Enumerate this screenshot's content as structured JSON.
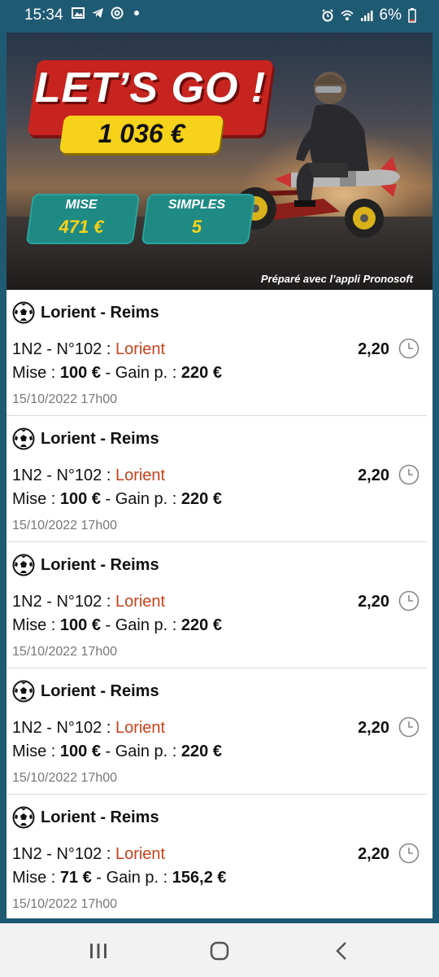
{
  "status_bar": {
    "time": "15:34",
    "battery": "6%",
    "left_icons": [
      "image-icon",
      "telegram-icon",
      "at-icon",
      "dot-icon"
    ],
    "right_icons": [
      "alarm-icon",
      "wifi-icon",
      "signal-icon",
      "battery-icon"
    ]
  },
  "banner": {
    "headline": "LET’S GO !",
    "amount": "1 036 €",
    "stats": [
      {
        "label": "MISE",
        "value": "471 €"
      },
      {
        "label": "SIMPLES",
        "value": "5"
      }
    ],
    "credit": "Préparé avec l’appli Pronosoft",
    "colors": {
      "red": "#c7241f",
      "yellow": "#f7d21a",
      "teal": "#1f8a84"
    }
  },
  "bets": [
    {
      "match": "Lorient - Reims",
      "bet_prefix": "1N2 - N°102 : ",
      "pick": "Lorient",
      "odds": "2,20",
      "stake_prefix": "Mise : ",
      "stake": "100 €",
      "gain_prefix": " - Gain p. : ",
      "gain": "220 €",
      "date": "15/10/2022 17h00"
    },
    {
      "match": "Lorient - Reims",
      "bet_prefix": "1N2 - N°102 : ",
      "pick": "Lorient",
      "odds": "2,20",
      "stake_prefix": "Mise : ",
      "stake": "100 €",
      "gain_prefix": " - Gain p. : ",
      "gain": "220 €",
      "date": "15/10/2022 17h00"
    },
    {
      "match": "Lorient - Reims",
      "bet_prefix": "1N2 - N°102 : ",
      "pick": "Lorient",
      "odds": "2,20",
      "stake_prefix": "Mise : ",
      "stake": "100 €",
      "gain_prefix": " - Gain p. : ",
      "gain": "220 €",
      "date": "15/10/2022 17h00"
    },
    {
      "match": "Lorient - Reims",
      "bet_prefix": "1N2 - N°102 : ",
      "pick": "Lorient",
      "odds": "2,20",
      "stake_prefix": "Mise : ",
      "stake": "100 €",
      "gain_prefix": " - Gain p. : ",
      "gain": "220 €",
      "date": "15/10/2022 17h00"
    },
    {
      "match": "Lorient - Reims",
      "bet_prefix": "1N2 - N°102 : ",
      "pick": "Lorient",
      "odds": "2,20",
      "stake_prefix": "Mise : ",
      "stake": "71 €",
      "gain_prefix": " - Gain p. : ",
      "gain": "156,2 €",
      "date": "15/10/2022 17h00"
    }
  ],
  "nav_bar": {
    "buttons": [
      "recent-apps-icon",
      "home-icon",
      "back-icon"
    ]
  }
}
